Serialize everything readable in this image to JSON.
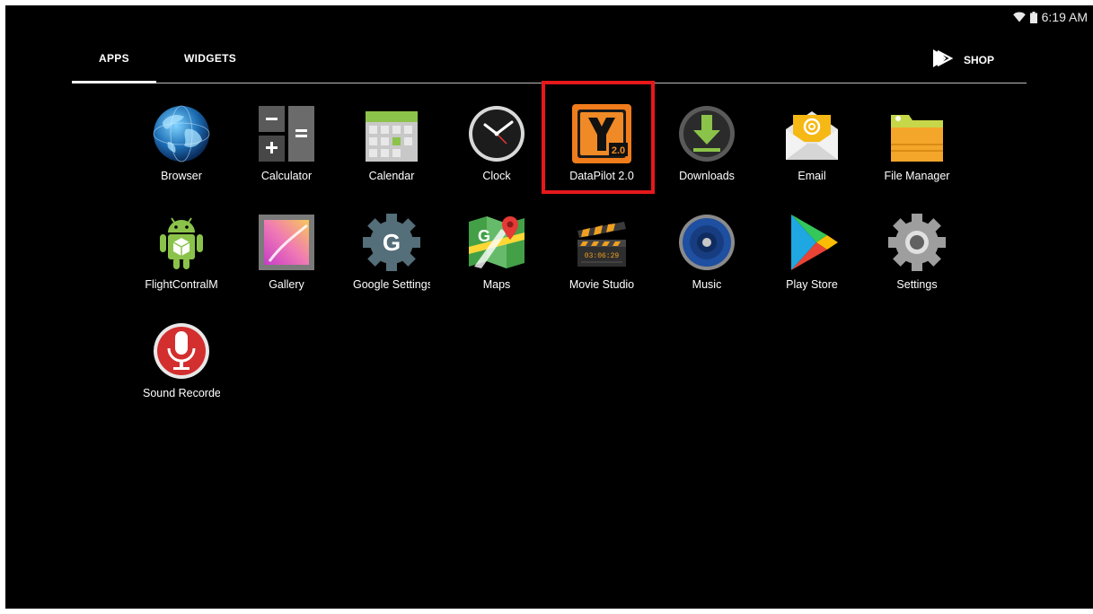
{
  "status_bar": {
    "time": "6:19 AM",
    "icons": [
      "wifi-icon",
      "battery-icon"
    ]
  },
  "tabs": [
    {
      "label": "APPS",
      "selected": true
    },
    {
      "label": "WIDGETS",
      "selected": false
    }
  ],
  "shop": {
    "label": "SHOP",
    "icon": "play-store-bag-icon"
  },
  "apps": [
    {
      "label": "Browser",
      "icon": "browser-globe-icon"
    },
    {
      "label": "Calculator",
      "icon": "calculator-icon"
    },
    {
      "label": "Calendar",
      "icon": "calendar-icon"
    },
    {
      "label": "Clock",
      "icon": "clock-icon"
    },
    {
      "label": "DataPilot 2.0",
      "icon": "datapilot-icon",
      "highlighted": true
    },
    {
      "label": "Downloads",
      "icon": "downloads-icon"
    },
    {
      "label": "Email",
      "icon": "email-icon"
    },
    {
      "label": "File Manager",
      "icon": "file-manager-icon"
    },
    {
      "label": "FlightContralM",
      "icon": "android-robot-icon"
    },
    {
      "label": "Gallery",
      "icon": "gallery-icon"
    },
    {
      "label": "Google Settings",
      "icon": "google-settings-icon"
    },
    {
      "label": "Maps",
      "icon": "maps-icon"
    },
    {
      "label": "Movie Studio",
      "icon": "movie-studio-icon"
    },
    {
      "label": "Music",
      "icon": "music-speaker-icon"
    },
    {
      "label": "Play Store",
      "icon": "play-store-icon"
    },
    {
      "label": "Settings",
      "icon": "settings-gear-icon"
    },
    {
      "label": "Sound Recorder",
      "icon": "microphone-icon"
    }
  ],
  "colors": {
    "background": "#000000",
    "highlight_box": "#e5181b",
    "datapilot_orange": "#f07c1c"
  }
}
